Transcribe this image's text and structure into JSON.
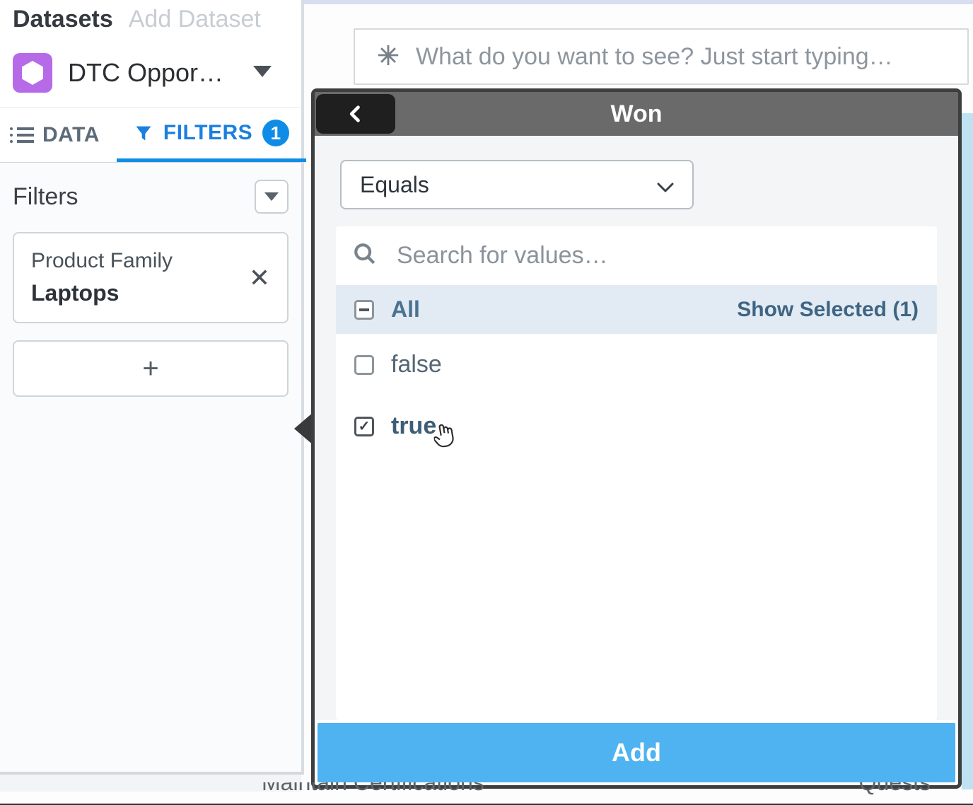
{
  "sidebar": {
    "datasets_label": "Datasets",
    "add_dataset_label": "Add Dataset",
    "dataset_name": "DTC Oppor…",
    "tabs": {
      "data": "DATA",
      "filters": "FILTERS",
      "filter_count": "1"
    },
    "filters_heading": "Filters",
    "filter_chip": {
      "field": "Product Family",
      "value": "Laptops"
    },
    "add_filter_symbol": "+"
  },
  "main": {
    "query_placeholder": "What do you want to see? Just start typing…"
  },
  "popup": {
    "title": "Won",
    "operator": "Equals",
    "search_placeholder": "Search for values…",
    "all_label": "All",
    "show_selected": "Show Selected (1)",
    "options": [
      {
        "label": "false",
        "selected": false
      },
      {
        "label": "true",
        "selected": true
      }
    ],
    "add_button": "Add"
  },
  "footer": {
    "left": "Maintain Certifications",
    "right": "Quests"
  }
}
